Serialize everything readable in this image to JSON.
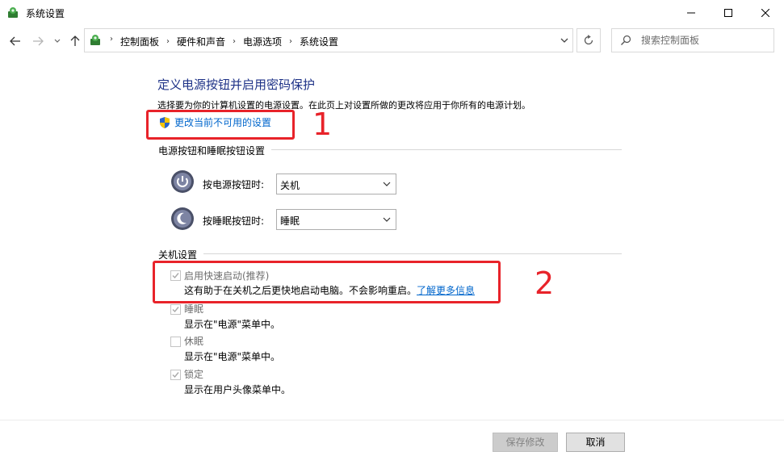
{
  "window": {
    "title": "系统设置"
  },
  "address": {
    "breadcrumbs": [
      "控制面板",
      "硬件和声音",
      "电源选项",
      "系统设置"
    ],
    "search_placeholder": "搜索控制面板"
  },
  "page": {
    "title": "定义电源按钮并启用密码保护",
    "description": "选择要为你的计算机设置的电源设置。在此页上对设置所做的更改将应用于你所有的电源计划。",
    "change_link": "更改当前不可用的设置"
  },
  "power_buttons": {
    "heading": "电源按钮和睡眠按钮设置",
    "power_label": "按电源按钮时:",
    "power_value": "关机",
    "sleep_label": "按睡眠按钮时:",
    "sleep_value": "睡眠"
  },
  "shutdown": {
    "heading": "关机设置",
    "items": [
      {
        "label": "启用快速启动(推荐)",
        "checked": true,
        "desc": "这有助于在关机之后更快地启动电脑。不会影响重启。",
        "link": "了解更多信息"
      },
      {
        "label": "睡眠",
        "checked": true,
        "desc": "显示在\"电源\"菜单中。"
      },
      {
        "label": "休眠",
        "checked": false,
        "desc": "显示在\"电源\"菜单中。"
      },
      {
        "label": "锁定",
        "checked": true,
        "desc": "显示在用户头像菜单中。"
      }
    ]
  },
  "annotations": {
    "one": "1",
    "two": "2"
  },
  "footer": {
    "save_label": "保存修改",
    "cancel_label": "取消"
  },
  "colors": {
    "title_blue": "#1e3287",
    "link_blue": "#0066cc",
    "annotation_red": "#e8232a"
  }
}
